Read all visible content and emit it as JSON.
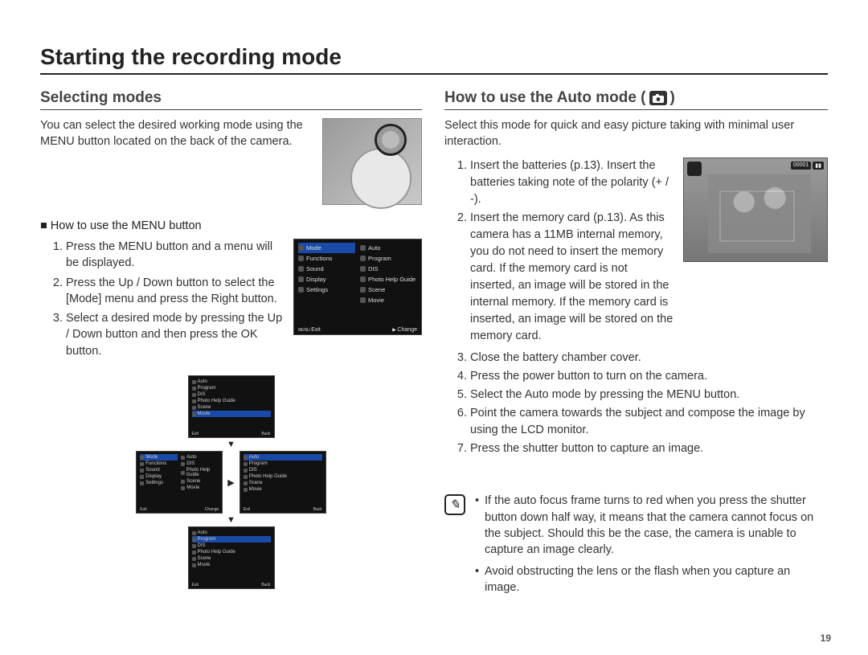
{
  "page_number": "19",
  "title": "Starting the recording mode",
  "left": {
    "heading": "Selecting modes",
    "intro": "You can select the desired working mode using the MENU button located on the back of the camera.",
    "subhead": "How to use the MENU button",
    "steps": [
      "Press the MENU button and a menu will be displayed.",
      "Press the Up / Down button to select the [Mode] menu and press the Right button.",
      "Select a desired mode by pressing the Up / Down button and then press the OK button."
    ],
    "menu": {
      "left_items": [
        "Mode",
        "Functions",
        "Sound",
        "Display",
        "Settings"
      ],
      "right_items": [
        "Auto",
        "Program",
        "DIS",
        "Photo Help Guide",
        "Scene",
        "Movie"
      ],
      "footer_left": "Exit",
      "footer_right": "Change"
    },
    "flow_items": [
      "Auto",
      "Program",
      "DIS",
      "Photo Help Guide",
      "Scene",
      "Movie"
    ],
    "flow_footer_left": "Exit",
    "flow_footer_right": "Back"
  },
  "right": {
    "heading_a": "How to use the Auto mode (",
    "heading_b": ")",
    "intro": "Select this mode for quick and easy picture taking with minimal user interaction.",
    "steps": [
      "Insert the batteries (p.13). Insert the batteries taking note of the polarity (+ / -).",
      "Insert the memory card (p.13). As this camera has a 11MB internal memory, you do not need to insert the memory card. If the memory card is not inserted, an image will be stored in the internal memory. If the memory card is inserted, an image will be stored on the memory card.",
      "Close the battery chamber cover.",
      "Press the power button to turn on the camera.",
      "Select the Auto mode by pressing the MENU button.",
      "Point the camera towards the subject and compose the image by using the LCD monitor.",
      "Press the shutter button to capture an image."
    ],
    "photo_osd": {
      "counter": "00001"
    },
    "notes": [
      "If the auto focus frame turns to red when you press the shutter button down half way, it means that the camera cannot focus on the subject. Should this be the case, the camera is unable to capture an image clearly.",
      "Avoid obstructing the lens or the flash when you capture an image."
    ]
  }
}
